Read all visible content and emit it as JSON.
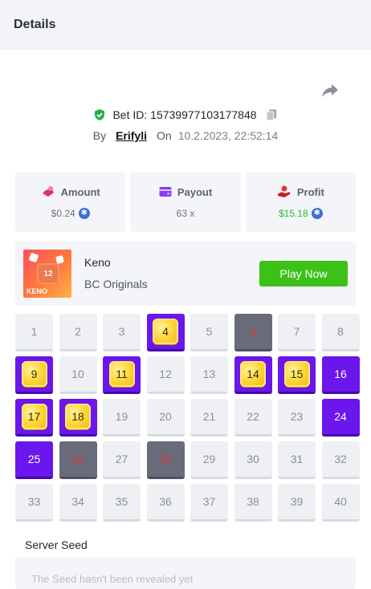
{
  "header": {
    "title": "Details"
  },
  "bet": {
    "id_label": "Bet ID: 15739977103177848",
    "by_label": "By",
    "user": "Erifyli",
    "on_label": "On",
    "date": "10.2.2023, 22:52:14"
  },
  "stats": {
    "amount": {
      "label": "Amount",
      "value": "$0.24",
      "icon": "wallet-hand-icon"
    },
    "payout": {
      "label": "Payout",
      "value": "63 x",
      "icon": "card-icon"
    },
    "profit": {
      "label": "Profit",
      "value": "$15.18",
      "icon": "hand-coin-icon",
      "color": "#2eb82e"
    }
  },
  "game": {
    "name": "Keno",
    "provider": "BC Originals",
    "thumb_label": "KENO",
    "thumb_number": "12",
    "play_label": "Play Now",
    "play_color": "#3bc117"
  },
  "keno": {
    "numbers": [
      {
        "n": "1",
        "state": "none"
      },
      {
        "n": "2",
        "state": "none"
      },
      {
        "n": "3",
        "state": "none"
      },
      {
        "n": "4",
        "state": "hit"
      },
      {
        "n": "5",
        "state": "none"
      },
      {
        "n": "6",
        "state": "drawn"
      },
      {
        "n": "7",
        "state": "none"
      },
      {
        "n": "8",
        "state": "none"
      },
      {
        "n": "9",
        "state": "hit"
      },
      {
        "n": "10",
        "state": "none"
      },
      {
        "n": "11",
        "state": "hit"
      },
      {
        "n": "12",
        "state": "none"
      },
      {
        "n": "13",
        "state": "none"
      },
      {
        "n": "14",
        "state": "hit"
      },
      {
        "n": "15",
        "state": "hit"
      },
      {
        "n": "16",
        "state": "picked"
      },
      {
        "n": "17",
        "state": "hit"
      },
      {
        "n": "18",
        "state": "hit"
      },
      {
        "n": "19",
        "state": "none"
      },
      {
        "n": "20",
        "state": "none"
      },
      {
        "n": "21",
        "state": "none"
      },
      {
        "n": "22",
        "state": "none"
      },
      {
        "n": "23",
        "state": "none"
      },
      {
        "n": "24",
        "state": "picked"
      },
      {
        "n": "25",
        "state": "picked"
      },
      {
        "n": "26",
        "state": "drawn"
      },
      {
        "n": "27",
        "state": "none"
      },
      {
        "n": "28",
        "state": "drawn"
      },
      {
        "n": "29",
        "state": "none"
      },
      {
        "n": "30",
        "state": "none"
      },
      {
        "n": "31",
        "state": "none"
      },
      {
        "n": "32",
        "state": "none"
      },
      {
        "n": "33",
        "state": "none"
      },
      {
        "n": "34",
        "state": "none"
      },
      {
        "n": "35",
        "state": "none"
      },
      {
        "n": "36",
        "state": "none"
      },
      {
        "n": "37",
        "state": "none"
      },
      {
        "n": "38",
        "state": "none"
      },
      {
        "n": "39",
        "state": "none"
      },
      {
        "n": "40",
        "state": "none"
      }
    ],
    "colors": {
      "picked": "#6a16ec",
      "drawn": "#676b7a",
      "hit_gem": "#ffd83a"
    }
  },
  "seed": {
    "label": "Server Seed",
    "placeholder": "The Seed hasn't been revealed yet"
  }
}
